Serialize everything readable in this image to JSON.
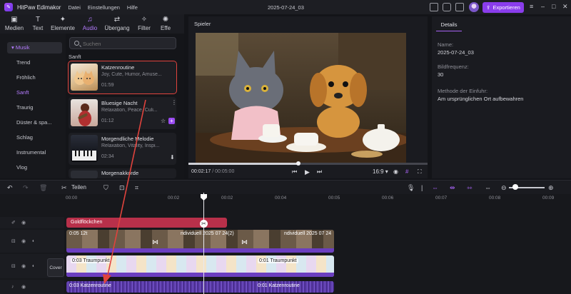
{
  "app": {
    "name": "HitPaw Edimakor",
    "menus": [
      "Datei",
      "Einstellungen",
      "Hilfe"
    ],
    "project_title": "2025-07-24_03",
    "export_label": "Exportieren"
  },
  "tool_tabs": [
    {
      "label": "Medien",
      "icon": "folder-icon"
    },
    {
      "label": "Text",
      "icon": "text-icon"
    },
    {
      "label": "Elemente",
      "icon": "elements-icon"
    },
    {
      "label": "Audio",
      "icon": "music-note-icon",
      "active": true
    },
    {
      "label": "Übergang",
      "icon": "transition-icon"
    },
    {
      "label": "Filter",
      "icon": "filter-icon"
    },
    {
      "label": "Effe",
      "icon": "effects-icon"
    }
  ],
  "categories": {
    "parent": "Musik",
    "items": [
      "Trend",
      "Fröhlich",
      "Sanft",
      "Traurig",
      "Düster & spa...",
      "Schlag",
      "Instrumental",
      "Vlog"
    ],
    "active": "Sanft"
  },
  "search": {
    "placeholder": "Suchen"
  },
  "music": {
    "section_title": "Sanft",
    "tracks": [
      {
        "name": "Katzenroutine",
        "tags": "Joy, Cute, Humor, Amuse...",
        "duration": "01:59"
      },
      {
        "name": "Bluesige Nacht",
        "tags": "Relaxation, Peace, Culi...",
        "duration": "01:12"
      },
      {
        "name": "Morgendliche Melodie",
        "tags": "Relaxation, Vitality, Inspi...",
        "duration": "02:34"
      },
      {
        "name": "Morgenakkorde",
        "tags": "",
        "duration": ""
      }
    ]
  },
  "player": {
    "title": "Spieler",
    "current_time": "00:02:17",
    "total_time": "00:05:00",
    "progress": 0.46,
    "aspect_ratio": "16:9"
  },
  "details": {
    "tab": "Details",
    "fields": [
      {
        "label": "Name:",
        "value": "2025-07-24_03"
      },
      {
        "label": "Bildfrequenz:",
        "value": "30"
      },
      {
        "label": "Methode der Einfuhr:",
        "value": "Am ursprünglichen Ort aufbewahren"
      }
    ]
  },
  "timeline_toolbar": {
    "split_label": "Teilen"
  },
  "ruler_ticks": [
    "00:00",
    "00:02",
    "00:02",
    "00:04",
    "00:05",
    "00:06",
    "00:07",
    "00:08",
    "00:09"
  ],
  "timeline": {
    "text_clip": "Goldflöckchen",
    "video_clip_label": "0:05 12t",
    "video_clip_label2": "ndividuell 2025 07 24(2)",
    "video_clip_label3": "ndividuell 2025 07 24",
    "sticker_clip1": "0:03 Traumpunkt",
    "sticker_clip2": "0:01 Traumpunkt",
    "audio_clip1": "0:03 Katzenroutine",
    "audio_clip2": "0:01 Katzenroutine",
    "cover_label": "Cover"
  },
  "colors": {
    "accent": "#8a3dec",
    "selection_outline": "#e0433d",
    "text_clip": "#c0304a",
    "audio_clip": "#5a3aa8"
  }
}
